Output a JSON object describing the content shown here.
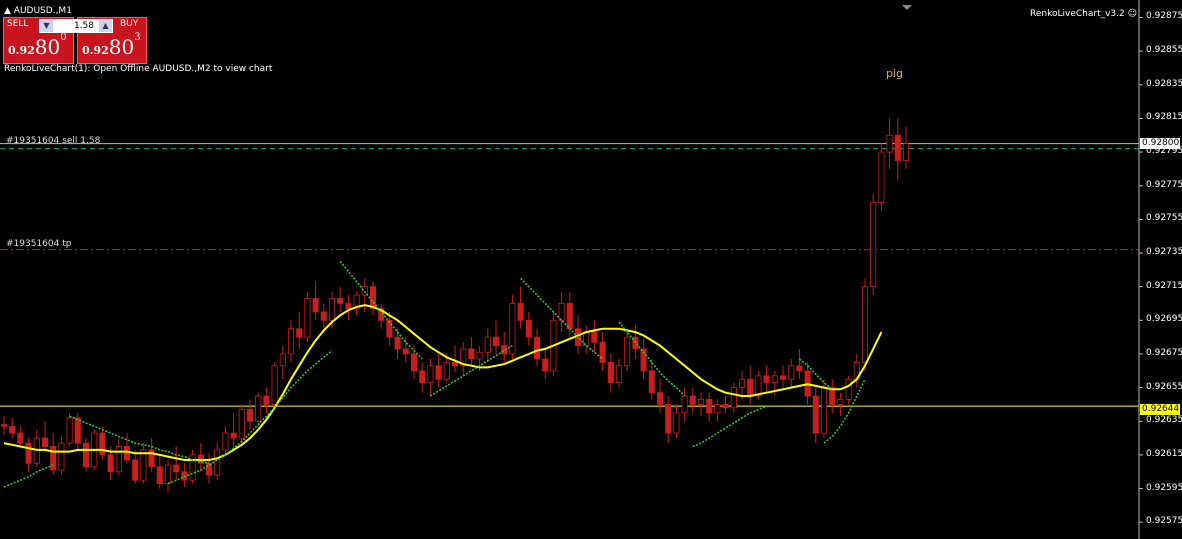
{
  "window": {
    "symbol_label": "AUDUSD.,M1",
    "indicator_name": "RenkoLiveChart_v3.2",
    "indicator_message": "RenkoLiveChart(1): Open Offline AUDUSD.,M2 to view chart"
  },
  "trade_panel": {
    "sell_label": "SELL",
    "buy_label": "BUY",
    "lot_value": "1.58",
    "sell_price": {
      "prefix": "0.92",
      "main": "80",
      "sup": "0"
    },
    "buy_price": {
      "prefix": "0.92",
      "main": "80",
      "sup": "3"
    }
  },
  "orders": {
    "sell_label": "#19351604 sell 1.58",
    "tp_label": "#19351604 tp"
  },
  "annotation": {
    "text": "pig"
  },
  "price_axis": {
    "labels": [
      "0.92875",
      "0.92855",
      "0.92835",
      "0.92815",
      "0.92795",
      "0.92775",
      "0.92755",
      "0.92735",
      "0.92715",
      "0.92695",
      "0.92675",
      "0.92655",
      "0.92635",
      "0.92615",
      "0.92595",
      "0.92575"
    ],
    "current_bid": "0.92800",
    "hline": "0.92644"
  },
  "colors": {
    "candle": "#c81e1e",
    "ma_yellow": "#ffff00",
    "envelope_green": "#32cd32",
    "sell_line": "#20c060",
    "tp_line": "#c81e1e",
    "hline": "#ffff00"
  },
  "chart_data": {
    "type": "line",
    "ylim": [
      0.92568,
      0.92883
    ],
    "levels": {
      "sell": 0.92797,
      "tp": 0.92737,
      "hline": 0.92644,
      "bid": 0.928
    },
    "candles": [
      [
        0.92633,
        0.92638,
        0.92627,
        0.92632
      ],
      [
        0.92632,
        0.92637,
        0.92625,
        0.92628
      ],
      [
        0.92628,
        0.92632,
        0.9262,
        0.92622
      ],
      [
        0.92622,
        0.92625,
        0.92605,
        0.9261
      ],
      [
        0.9261,
        0.9263,
        0.92608,
        0.92625
      ],
      [
        0.92625,
        0.92635,
        0.92618,
        0.9262
      ],
      [
        0.9262,
        0.92628,
        0.92603,
        0.92606
      ],
      [
        0.92606,
        0.92626,
        0.92603,
        0.92622
      ],
      [
        0.92622,
        0.9264,
        0.9262,
        0.92637
      ],
      [
        0.92637,
        0.9264,
        0.92618,
        0.92622
      ],
      [
        0.92622,
        0.92625,
        0.92605,
        0.92608
      ],
      [
        0.92608,
        0.9263,
        0.92606,
        0.92628
      ],
      [
        0.92628,
        0.92632,
        0.92612,
        0.92615
      ],
      [
        0.92615,
        0.9262,
        0.926,
        0.92605
      ],
      [
        0.92605,
        0.92625,
        0.92603,
        0.9262
      ],
      [
        0.9262,
        0.92628,
        0.9261,
        0.92612
      ],
      [
        0.92612,
        0.92618,
        0.92598,
        0.926
      ],
      [
        0.926,
        0.92622,
        0.92598,
        0.92618
      ],
      [
        0.92618,
        0.92625,
        0.92605,
        0.92608
      ],
      [
        0.92608,
        0.92615,
        0.92595,
        0.92598
      ],
      [
        0.92598,
        0.92612,
        0.92593,
        0.92609
      ],
      [
        0.92609,
        0.9262,
        0.926,
        0.92605
      ],
      [
        0.92605,
        0.9261,
        0.92596,
        0.926
      ],
      [
        0.926,
        0.92618,
        0.92598,
        0.92615
      ],
      [
        0.92615,
        0.92622,
        0.92605,
        0.9261
      ],
      [
        0.9261,
        0.92616,
        0.92598,
        0.92603
      ],
      [
        0.92603,
        0.92622,
        0.926,
        0.92618
      ],
      [
        0.92618,
        0.92632,
        0.92615,
        0.92628
      ],
      [
        0.92628,
        0.9264,
        0.9262,
        0.92625
      ],
      [
        0.92625,
        0.92645,
        0.92622,
        0.92642
      ],
      [
        0.92642,
        0.92648,
        0.9263,
        0.92635
      ],
      [
        0.92635,
        0.92652,
        0.92632,
        0.9265
      ],
      [
        0.9265,
        0.92655,
        0.9264,
        0.92645
      ],
      [
        0.92645,
        0.9267,
        0.92642,
        0.92668
      ],
      [
        0.92668,
        0.9268,
        0.9266,
        0.92675
      ],
      [
        0.92675,
        0.92695,
        0.9267,
        0.9269
      ],
      [
        0.9269,
        0.927,
        0.92678,
        0.92685
      ],
      [
        0.92685,
        0.92712,
        0.92682,
        0.92708
      ],
      [
        0.92708,
        0.92718,
        0.92695,
        0.927
      ],
      [
        0.927,
        0.92705,
        0.92688,
        0.92695
      ],
      [
        0.92695,
        0.92712,
        0.9269,
        0.92708
      ],
      [
        0.92708,
        0.92715,
        0.927,
        0.92705
      ],
      [
        0.92705,
        0.9271,
        0.92695,
        0.92702
      ],
      [
        0.92702,
        0.92712,
        0.92698,
        0.9271
      ],
      [
        0.9271,
        0.9272,
        0.927,
        0.92715
      ],
      [
        0.92715,
        0.92718,
        0.92698,
        0.92702
      ],
      [
        0.92702,
        0.92705,
        0.9269,
        0.92695
      ],
      [
        0.92695,
        0.927,
        0.9268,
        0.92685
      ],
      [
        0.92685,
        0.9269,
        0.92672,
        0.92678
      ],
      [
        0.92678,
        0.92685,
        0.9267,
        0.92675
      ],
      [
        0.92675,
        0.9268,
        0.9266,
        0.92665
      ],
      [
        0.92665,
        0.9267,
        0.92652,
        0.92658
      ],
      [
        0.92658,
        0.92672,
        0.9265,
        0.92668
      ],
      [
        0.92668,
        0.92675,
        0.92655,
        0.9266
      ],
      [
        0.9266,
        0.92675,
        0.92658,
        0.9267
      ],
      [
        0.9267,
        0.9268,
        0.92664,
        0.92668
      ],
      [
        0.92668,
        0.92682,
        0.92662,
        0.92678
      ],
      [
        0.92678,
        0.92685,
        0.92668,
        0.92672
      ],
      [
        0.92672,
        0.9268,
        0.92665,
        0.92676
      ],
      [
        0.92676,
        0.9269,
        0.9267,
        0.92685
      ],
      [
        0.92685,
        0.92695,
        0.92675,
        0.9268
      ],
      [
        0.9268,
        0.92688,
        0.9267,
        0.92675
      ],
      [
        0.92675,
        0.9271,
        0.92672,
        0.92705
      ],
      [
        0.92705,
        0.92715,
        0.9269,
        0.92695
      ],
      [
        0.92695,
        0.927,
        0.9268,
        0.92685
      ],
      [
        0.92685,
        0.9269,
        0.92668,
        0.92672
      ],
      [
        0.92672,
        0.92678,
        0.9266,
        0.92665
      ],
      [
        0.92665,
        0.927,
        0.92662,
        0.92695
      ],
      [
        0.92695,
        0.92712,
        0.92688,
        0.92705
      ],
      [
        0.92705,
        0.92712,
        0.92685,
        0.9269
      ],
      [
        0.9269,
        0.92698,
        0.92675,
        0.9268
      ],
      [
        0.9268,
        0.92692,
        0.92675,
        0.92688
      ],
      [
        0.92688,
        0.92695,
        0.92676,
        0.92682
      ],
      [
        0.92682,
        0.92688,
        0.92665,
        0.9267
      ],
      [
        0.9267,
        0.92675,
        0.92652,
        0.92658
      ],
      [
        0.92658,
        0.92672,
        0.92655,
        0.92668
      ],
      [
        0.92668,
        0.9269,
        0.92665,
        0.92685
      ],
      [
        0.92685,
        0.92692,
        0.92672,
        0.92678
      ],
      [
        0.92678,
        0.92684,
        0.9266,
        0.92665
      ],
      [
        0.92665,
        0.92672,
        0.92648,
        0.92652
      ],
      [
        0.92652,
        0.9266,
        0.9264,
        0.92645
      ],
      [
        0.92645,
        0.9265,
        0.92622,
        0.92628
      ],
      [
        0.92628,
        0.92645,
        0.92625,
        0.9264
      ],
      [
        0.9264,
        0.92655,
        0.92635,
        0.9265
      ],
      [
        0.9265,
        0.92655,
        0.9264,
        0.92645
      ],
      [
        0.92645,
        0.92652,
        0.92638,
        0.92648
      ],
      [
        0.92648,
        0.92652,
        0.92635,
        0.9264
      ],
      [
        0.9264,
        0.92648,
        0.92635,
        0.92645
      ],
      [
        0.92645,
        0.9265,
        0.9264,
        0.92643
      ],
      [
        0.92643,
        0.92658,
        0.9264,
        0.92655
      ],
      [
        0.92655,
        0.92665,
        0.92648,
        0.9266
      ],
      [
        0.9266,
        0.92668,
        0.92645,
        0.9265
      ],
      [
        0.9265,
        0.92665,
        0.92648,
        0.92662
      ],
      [
        0.92662,
        0.92668,
        0.92652,
        0.92658
      ],
      [
        0.92658,
        0.92665,
        0.9265,
        0.92662
      ],
      [
        0.92662,
        0.92668,
        0.92655,
        0.9266
      ],
      [
        0.9266,
        0.92672,
        0.92655,
        0.92668
      ],
      [
        0.92668,
        0.92678,
        0.9266,
        0.92665
      ],
      [
        0.92665,
        0.9267,
        0.92645,
        0.9265
      ],
      [
        0.9265,
        0.92655,
        0.92622,
        0.92628
      ],
      [
        0.92628,
        0.9266,
        0.92625,
        0.92655
      ],
      [
        0.92655,
        0.9266,
        0.9264,
        0.92645
      ],
      [
        0.92645,
        0.92652,
        0.92638,
        0.92648
      ],
      [
        0.92648,
        0.92662,
        0.92645,
        0.9266
      ],
      [
        0.9266,
        0.92675,
        0.92655,
        0.9267
      ],
      [
        0.9267,
        0.9272,
        0.92665,
        0.92715
      ],
      [
        0.92715,
        0.9277,
        0.9271,
        0.92765
      ],
      [
        0.92765,
        0.928,
        0.9276,
        0.92795
      ],
      [
        0.92795,
        0.92815,
        0.92785,
        0.92805
      ],
      [
        0.92805,
        0.92815,
        0.92778,
        0.9279
      ],
      [
        0.9279,
        0.9281,
        0.92785,
        0.928
      ]
    ],
    "series": [
      {
        "values": [
          0.92622,
          0.92621,
          0.9262,
          0.92619,
          0.92618,
          0.92618,
          0.92617,
          0.92617,
          0.92617,
          0.92618,
          0.92618,
          0.92618,
          0.92618,
          0.92617,
          0.92617,
          0.92617,
          0.92616,
          0.92616,
          0.92616,
          0.92615,
          0.92614,
          0.92613,
          0.92612,
          0.92612,
          0.92612,
          0.92612,
          0.92613,
          0.92615,
          0.92618,
          0.92621,
          0.92625,
          0.9263,
          0.92636,
          0.92643,
          0.92651,
          0.9266,
          0.92668,
          0.92676,
          0.92683,
          0.92689,
          0.92694,
          0.92698,
          0.92701,
          0.92703,
          0.92704,
          0.92703,
          0.92701,
          0.92698,
          0.92695,
          0.92691,
          0.92687,
          0.92683,
          0.92679,
          0.92676,
          0.92673,
          0.92671,
          0.92669,
          0.92668,
          0.92667,
          0.92667,
          0.92668,
          0.92669,
          0.92671,
          0.92673,
          0.92675,
          0.92677,
          0.92678,
          0.9268,
          0.92682,
          0.92684,
          0.92686,
          0.92688,
          0.92689,
          0.9269,
          0.9269,
          0.9269,
          0.92689,
          0.92688,
          0.92686,
          0.92683,
          0.9268,
          0.92676,
          0.92672,
          0.92668,
          0.92664,
          0.9266,
          0.92657,
          0.92654,
          0.92652,
          0.92651,
          0.9265,
          0.9265,
          0.92651,
          0.92652,
          0.92653,
          0.92654,
          0.92655,
          0.92656,
          0.92657,
          0.92656,
          0.92655,
          0.92654,
          0.92654,
          0.92656,
          0.9266,
          0.92668,
          0.92678,
          0.92688
        ]
      },
      {
        "values": [
          null,
          null,
          null,
          null,
          null,
          null,
          null,
          null,
          0.92638,
          0.92636,
          0.92634,
          0.92632,
          0.9263,
          0.92628,
          0.92626,
          0.92624,
          0.92622,
          0.92621,
          0.9262,
          0.92618,
          0.92617,
          0.92615,
          0.92614,
          0.92612,
          0.92611,
          0.9261,
          null,
          null,
          null,
          null,
          null,
          null,
          null,
          null,
          null,
          null,
          null,
          null,
          null,
          null,
          null,
          0.9273,
          0.92724,
          0.92718,
          0.92712,
          0.92706,
          0.927,
          0.92694,
          0.92688,
          0.92682,
          0.92677,
          0.92672,
          null,
          null,
          null,
          null,
          null,
          null,
          null,
          null,
          null,
          null,
          null,
          0.9272,
          0.92715,
          0.9271,
          0.92705,
          0.927,
          0.92695,
          0.9269,
          0.92685,
          0.9268,
          0.92676,
          0.92672,
          null,
          0.92694,
          0.92688,
          0.92682,
          0.92676,
          0.9267,
          0.92664,
          0.92659,
          0.92655,
          0.9265,
          null,
          null,
          null,
          null,
          null,
          null,
          null,
          null,
          null,
          null,
          null,
          null,
          null,
          0.92672,
          0.92668,
          0.92663,
          0.92658,
          0.92654,
          null,
          null,
          null,
          null,
          null,
          null,
          null,
          null,
          null,
          null
        ]
      },
      {
        "values": [
          0.92596,
          0.92598,
          0.926,
          0.92602,
          0.92605,
          0.92607,
          0.92609,
          null,
          null,
          null,
          null,
          null,
          null,
          null,
          null,
          null,
          null,
          null,
          null,
          null,
          0.92598,
          0.926,
          0.92602,
          0.92604,
          0.92606,
          0.92609,
          0.92612,
          0.92615,
          0.92619,
          0.92623,
          0.92628,
          0.92633,
          0.92638,
          0.92643,
          0.92649,
          0.92655,
          0.9266,
          0.92665,
          0.92669,
          0.92673,
          0.92677,
          null,
          null,
          null,
          null,
          null,
          null,
          null,
          null,
          null,
          null,
          null,
          0.9265,
          0.92653,
          0.92656,
          0.92659,
          0.92662,
          0.92665,
          0.92668,
          0.92671,
          0.92674,
          0.92677,
          0.9268,
          null,
          null,
          null,
          null,
          null,
          null,
          null,
          null,
          null,
          null,
          null,
          null,
          null,
          null,
          null,
          null,
          null,
          null,
          null,
          null,
          null,
          0.9262,
          0.92622,
          0.92625,
          0.92628,
          0.92631,
          0.92634,
          0.92637,
          0.9264,
          0.92642,
          0.92644,
          null,
          null,
          null,
          null,
          null,
          null,
          0.92622,
          0.92626,
          0.92632,
          0.9264,
          0.9265,
          0.9266
        ]
      }
    ]
  }
}
